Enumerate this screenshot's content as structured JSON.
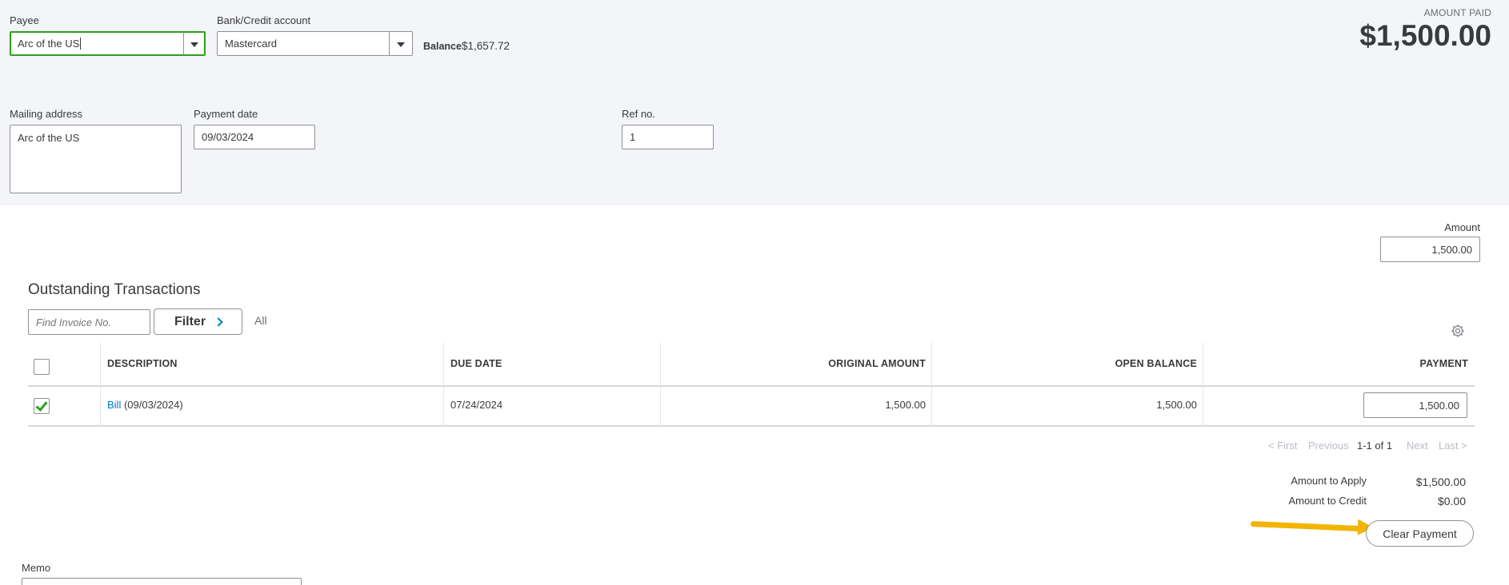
{
  "header": {
    "payee_label": "Payee",
    "payee_value": "Arc of the US",
    "bank_label": "Bank/Credit account",
    "bank_value": "Mastercard",
    "balance_label": "Balance",
    "balance_value": "$1,657.72",
    "amount_paid_label": "AMOUNT PAID",
    "amount_paid_value": "$1,500.00"
  },
  "details": {
    "mailing_label": "Mailing address",
    "mailing_value": "Arc of the US",
    "date_label": "Payment date",
    "date_value": "09/03/2024",
    "ref_label": "Ref no.",
    "ref_value": "1"
  },
  "amount": {
    "label": "Amount",
    "value": "1,500.00"
  },
  "outstanding": {
    "title": "Outstanding Transactions",
    "find_placeholder": "Find Invoice No.",
    "filter_label": "Filter",
    "all_label": "All",
    "columns": [
      "DESCRIPTION",
      "DUE DATE",
      "ORIGINAL AMOUNT",
      "OPEN BALANCE",
      "PAYMENT"
    ],
    "rows": [
      {
        "checked": true,
        "desc_link": "Bill",
        "desc_rest": "(09/03/2024)",
        "due_date": "07/24/2024",
        "original_amount": "1,500.00",
        "open_balance": "1,500.00",
        "payment": "1,500.00"
      }
    ]
  },
  "pagination": {
    "first": "< First",
    "previous": "Previous",
    "range": "1-1 of 1",
    "next": "Next",
    "last": "Last >"
  },
  "summary": {
    "apply_label": "Amount to Apply",
    "apply_value": "$1,500.00",
    "credit_label": "Amount to Credit",
    "credit_value": "$0.00",
    "clear_button": "Clear Payment"
  },
  "memo": {
    "label": "Memo"
  },
  "colors": {
    "accent_green": "#2ca01c",
    "link_blue": "#0077c5",
    "annotation_arrow": "#f2b400"
  }
}
